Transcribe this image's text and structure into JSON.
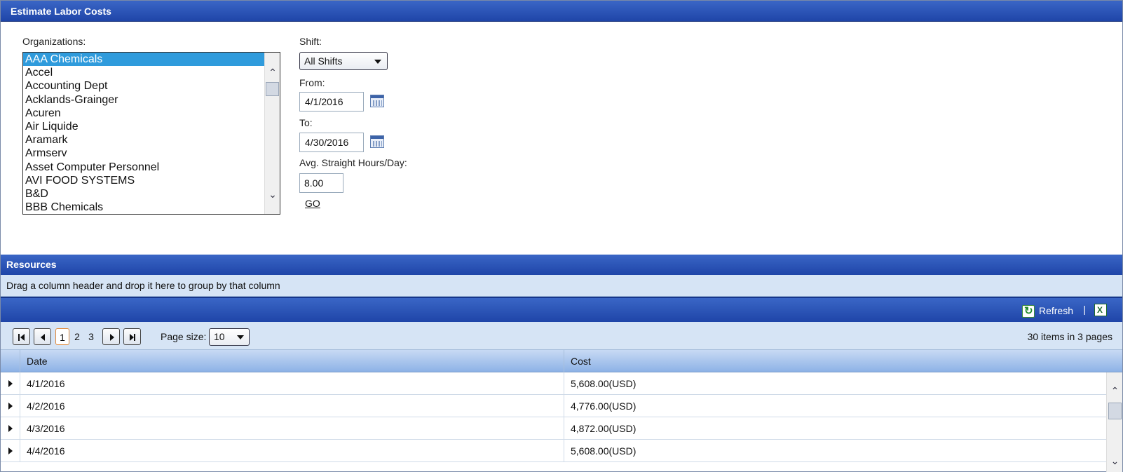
{
  "panel": {
    "title": "Estimate Labor Costs"
  },
  "form": {
    "organizations_label": "Organizations:",
    "organizations": [
      "AAA Chemicals",
      "Accel",
      "Accounting Dept",
      "Acklands-Grainger",
      "Acuren",
      "Air Liquide",
      "Aramark",
      "Armserv",
      "Asset Computer Personnel",
      "AVI FOOD SYSTEMS",
      "B&D",
      "BBB Chemicals"
    ],
    "selected_organization": "AAA Chemicals",
    "shift_label": "Shift:",
    "shift_value": "All Shifts",
    "from_label": "From:",
    "from_value": "4/1/2016",
    "to_label": "To:",
    "to_value": "4/30/2016",
    "hours_label": "Avg. Straight Hours/Day:",
    "hours_value": "8.00",
    "go_label": "GO"
  },
  "grid": {
    "title": "Resources",
    "group_hint": "Drag a column header and drop it here to group by that column",
    "toolbar": {
      "refresh_label": "Refresh",
      "separator": "|",
      "export_icon": "excel-export-icon"
    },
    "pager": {
      "pages": [
        "1",
        "2",
        "3"
      ],
      "current_page": "1",
      "page_size_label": "Page size:",
      "page_size_value": "10",
      "items_info": "30 items in 3 pages"
    },
    "columns": {
      "date": "Date",
      "cost": "Cost"
    },
    "rows": [
      {
        "date": "4/1/2016",
        "cost": "5,608.00(USD)"
      },
      {
        "date": "4/2/2016",
        "cost": "4,776.00(USD)"
      },
      {
        "date": "4/3/2016",
        "cost": "4,872.00(USD)"
      },
      {
        "date": "4/4/2016",
        "cost": "5,608.00(USD)"
      }
    ]
  },
  "colors": {
    "header_blue": "#2a52b5",
    "selection_blue": "#2f9bdc",
    "panel_light_blue": "#d6e4f5"
  }
}
